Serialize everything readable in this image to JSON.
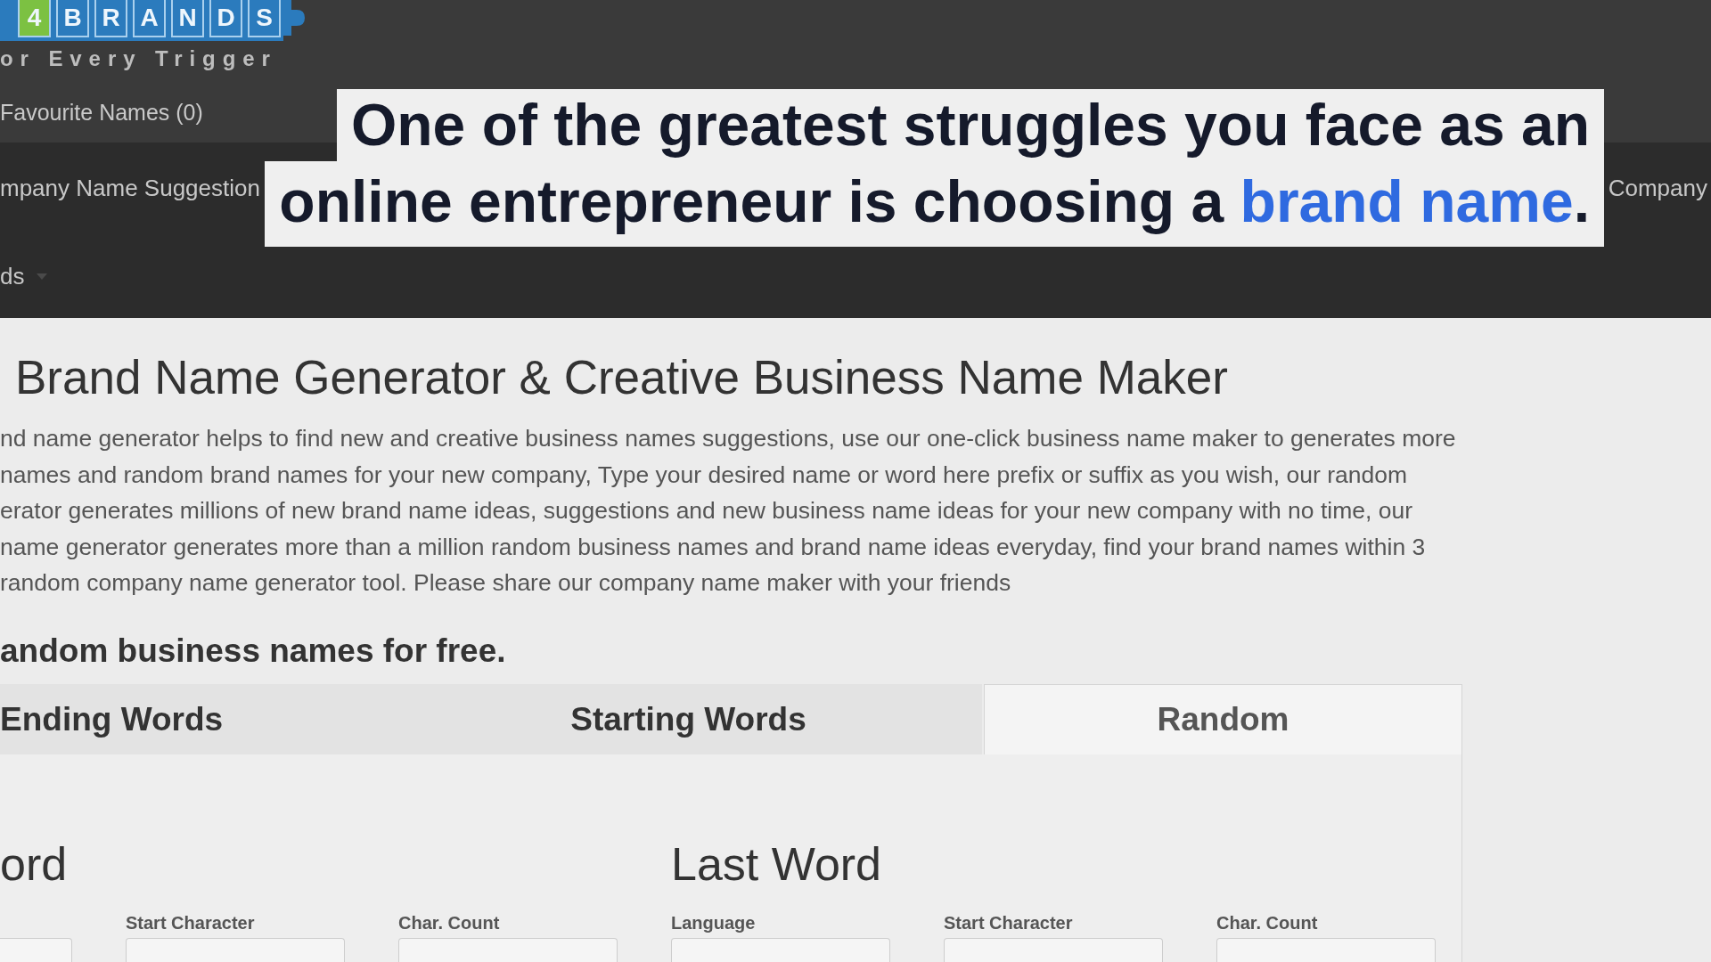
{
  "header": {
    "logo": {
      "tiles": [
        {
          "letter": "4",
          "color": "#7cc142"
        },
        {
          "letter": "B",
          "color": "#2b7bbd"
        },
        {
          "letter": "R",
          "color": "#2b7bbd"
        },
        {
          "letter": "A",
          "color": "#2b7bbd"
        },
        {
          "letter": "N",
          "color": "#2b7bbd"
        },
        {
          "letter": "D",
          "color": "#2b7bbd"
        },
        {
          "letter": "S",
          "color": "#2b7bbd"
        }
      ],
      "tagline": "or Every Trigger"
    },
    "favourites_link": "Favourite Names (0)"
  },
  "nav": {
    "items": [
      {
        "label": "mpany Name Suggestion"
      },
      {
        "label": "Company"
      }
    ],
    "dropdown": {
      "label": "ds"
    }
  },
  "caption": {
    "lines": [
      [
        {
          "kind": "plain",
          "text": "One of the greatest struggles you face as an"
        }
      ],
      [
        {
          "kind": "plain",
          "text": "online entrepreneur is choosing a "
        },
        {
          "kind": "accent",
          "text": "brand name"
        },
        {
          "kind": "plain",
          "text": "."
        }
      ]
    ]
  },
  "content": {
    "title": "Brand Name Generator & Creative Business Name Maker",
    "intro_lines": [
      "nd name generator helps to find new and creative business names suggestions, use our one-click business name maker to generates more",
      "names and random brand names for your new company, Type your desired name or word here prefix or suffix as you wish, our random",
      "erator generates millions of new brand name ideas, suggestions and new business name ideas for your new company with no time, our",
      "name generator generates more than a million random business names and brand name ideas everyday, find your brand names within 3",
      "random company name generator tool. Please share our company name maker with your friends"
    ],
    "subheading": "andom business names for free.",
    "tabs": [
      {
        "label": "Ending Words",
        "selected": false
      },
      {
        "label": "Starting Words",
        "selected": false
      },
      {
        "label": "Random",
        "selected": true
      }
    ],
    "word_groups": [
      {
        "heading": "ord",
        "fields": [
          {
            "kind": "select"
          },
          {
            "kind": "select",
            "label": "Start Character"
          },
          {
            "kind": "select",
            "label": "Char. Count"
          }
        ]
      },
      {
        "heading": "Last Word",
        "fields": [
          {
            "kind": "select",
            "label": "Language"
          },
          {
            "kind": "select",
            "label": "Start Character"
          },
          {
            "kind": "select",
            "label": "Char. Count"
          }
        ]
      }
    ]
  }
}
